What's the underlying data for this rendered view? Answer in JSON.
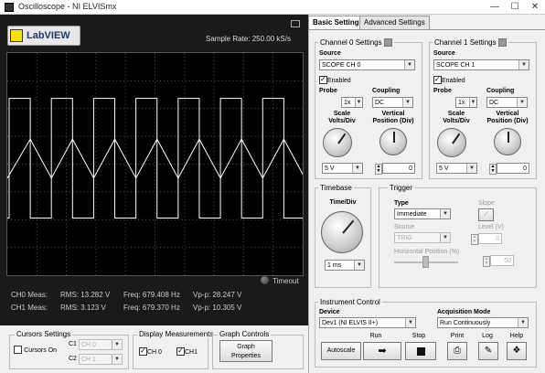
{
  "window": {
    "title": "Oscilloscope - NI ELVISmx",
    "minimize": "—",
    "maximize": "☐",
    "close": "✕"
  },
  "display": {
    "logo": "LabVIEW",
    "sample_rate": "Sample Rate:   250.00 kS/s",
    "timeout": "Timeout",
    "ch0": {
      "label": "CH0 Meas:",
      "rms": "RMS:  13.282 V",
      "freq": "Freq:  679.408 Hz",
      "vpp": "Vp-p:  28.247 V"
    },
    "ch1": {
      "label": "CH1 Meas:",
      "rms": "RMS:  3.123 V",
      "freq": "Freq:  679.370 Hz",
      "vpp": "Vp-p:  10.305 V"
    }
  },
  "cursors": {
    "title": "Cursors Settings",
    "cursors_on": "Cursors On",
    "c1": "C1",
    "c2": "C2",
    "c1_value": "CH 0",
    "c2_value": "CH 1"
  },
  "display_measurements": {
    "title": "Display Measurements",
    "ch0": "CH 0",
    "ch1": "CH1"
  },
  "graph_controls": {
    "title": "Graph Controls",
    "button": "Graph\nProperties"
  },
  "tabs": [
    "Basic Settings",
    "Advanced Settings"
  ],
  "channels": [
    {
      "title": "Channel 0 Settings",
      "source_label": "Source",
      "source": "SCOPE CH 0",
      "enabled": "Enabled",
      "probe_label": "Probe",
      "probe": "1x",
      "coupling_label": "Coupling",
      "coupling": "DC",
      "scale_label": "Scale\nVolts/Div",
      "vpos_label": "Vertical\nPosition (Div)",
      "scale": "5 V",
      "vpos": "0"
    },
    {
      "title": "Channel 1 Settings",
      "source_label": "Source",
      "source": "SCOPE CH 1",
      "enabled": "Enabled",
      "probe_label": "Probe",
      "probe": "1x",
      "coupling_label": "Coupling",
      "coupling": "DC",
      "scale_label": "Scale\nVolts/Div",
      "vpos_label": "Vertical\nPosition (Div)",
      "scale": "5 V",
      "vpos": "0"
    }
  ],
  "timebase": {
    "title": "Timebase",
    "label": "Time/Div",
    "value": "1 ms"
  },
  "trigger": {
    "title": "Trigger",
    "type_label": "Type",
    "type": "Immediate",
    "source_label": "Source",
    "source": "TRIG",
    "slope_label": "Slope",
    "level_label": "Level (V)",
    "level": "0",
    "hpos_label": "Horizontal Position (%)",
    "hpos": "50"
  },
  "instrument": {
    "title": "Instrument Control",
    "device_label": "Device",
    "device": "Dev1 (NI ELVIS II+)",
    "acq_label": "Acquisition Mode",
    "acq": "Run Continuously",
    "autoscale": "Autoscale",
    "run": "Run",
    "stop": "Stop",
    "print": "Print",
    "log": "Log",
    "help": "Help"
  },
  "colors": {
    "graph_bg": "#000000",
    "trace": "#ffffff",
    "grid": "#555555",
    "panel_dark": "#1a1a1a"
  }
}
